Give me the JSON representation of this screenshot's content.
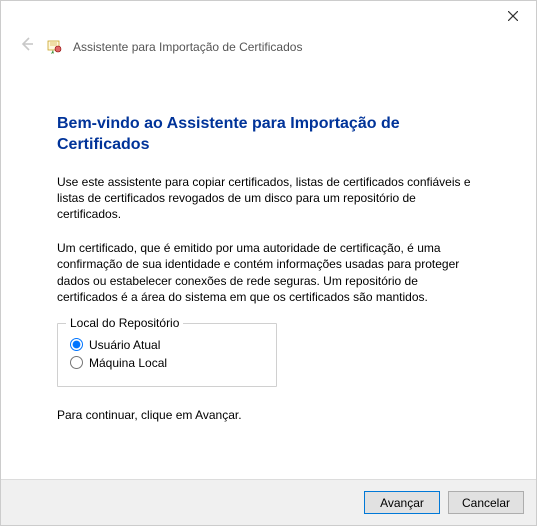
{
  "header": {
    "wizard_title": "Assistente para Importação de Certificados"
  },
  "content": {
    "heading": "Bem-vindo ao Assistente para Importação de Certificados",
    "para1": "Use este assistente para copiar certificados, listas de certificados confiáveis e listas de certificados revogados de um disco para um repositório de certificados.",
    "para2": "Um certificado, que é emitido por uma autoridade de certificação, é uma confirmação de sua identidade e contém informações usadas para proteger dados ou estabelecer conexões de rede seguras. Um repositório de certificados é a área do sistema em que os certificados são mantidos.",
    "group_title": "Local do Repositório",
    "radio1_label": "Usuário Atual",
    "radio2_label": "Máquina Local",
    "continue_text": "Para continuar, clique em Avançar."
  },
  "footer": {
    "next_label": "Avançar",
    "cancel_label": "Cancelar"
  }
}
